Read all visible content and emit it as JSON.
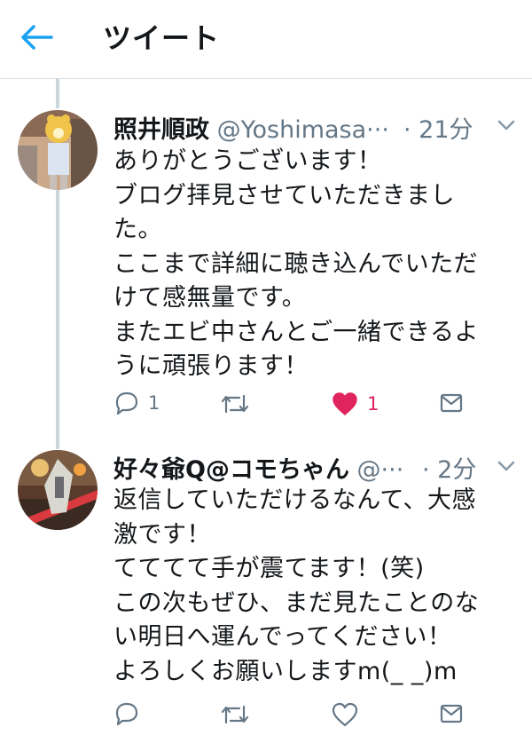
{
  "header": {
    "title": "ツイート",
    "back_icon": "arrow-left-icon",
    "accent": "#1da1f2"
  },
  "tweets": [
    {
      "name": "照井順政",
      "handle": "@Yoshimasa···",
      "time": "· 21分",
      "text": "ありがとうございます！\nブログ拝見させていただきまし\nた。\nここまで詳細に聴き込んでいただ\nけて感無量です。\nまたエビ中さんとご一緒できるよ\nうに頑張ります！",
      "reply_count": "1",
      "retweet_count": "",
      "like_count": "1",
      "liked": true
    },
    {
      "name": "好々爺Q@コモちゃん",
      "handle": "@···",
      "time": "· 2分",
      "text": "返信していただけるなんて、大感\n激です！\nてててて手が震てます！(笑)\nこの次もぜひ、まだ見たことのな\nい明日へ運んでってください！\nよろしくお願いしますm(_ _)m",
      "reply_count": "",
      "retweet_count": "",
      "like_count": "",
      "liked": false
    }
  ],
  "icons": [
    "reply-icon",
    "retweet-icon",
    "like-icon",
    "dm-icon",
    "chevron-down-icon"
  ],
  "colors": {
    "like": "#e0245e",
    "icon": "#657786",
    "thread_line": "#ccd6dd"
  }
}
